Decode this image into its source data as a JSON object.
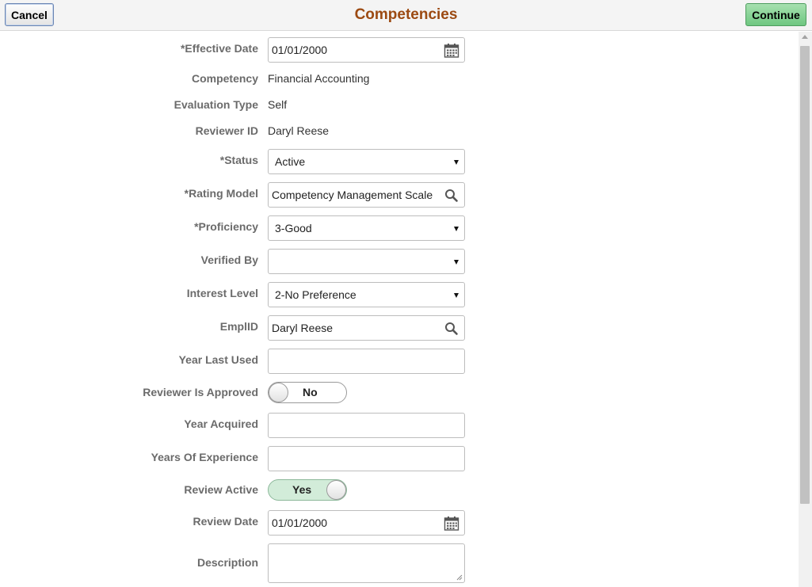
{
  "header": {
    "title": "Competencies",
    "cancel_label": "Cancel",
    "continue_label": "Continue"
  },
  "form": {
    "effective_date": {
      "label": "*Effective Date",
      "value": "01/01/2000",
      "icon": "calendar-icon"
    },
    "competency": {
      "label": "Competency",
      "value": "Financial Accounting"
    },
    "evaluation_type": {
      "label": "Evaluation Type",
      "value": "Self"
    },
    "reviewer_id": {
      "label": "Reviewer ID",
      "value": "Daryl Reese"
    },
    "status": {
      "label": "*Status",
      "value": "Active"
    },
    "rating_model": {
      "label": "*Rating Model",
      "value": "Competency Management Scale",
      "icon": "search-icon"
    },
    "proficiency": {
      "label": "*Proficiency",
      "value": "3-Good"
    },
    "verified_by": {
      "label": "Verified By",
      "value": ""
    },
    "interest_level": {
      "label": "Interest Level",
      "value": "2-No Preference"
    },
    "emplid": {
      "label": "EmplID",
      "value": "Daryl Reese",
      "icon": "search-icon"
    },
    "year_last_used": {
      "label": "Year Last Used",
      "value": ""
    },
    "reviewer_is_approved": {
      "label": "Reviewer Is Approved",
      "value": "No",
      "state": "off"
    },
    "year_acquired": {
      "label": "Year Acquired",
      "value": ""
    },
    "years_of_experience": {
      "label": "Years Of Experience",
      "value": ""
    },
    "review_active": {
      "label": "Review Active",
      "value": "Yes",
      "state": "on"
    },
    "review_date": {
      "label": "Review Date",
      "value": "01/01/2000",
      "icon": "calendar-icon"
    },
    "description": {
      "label": "Description",
      "value": ""
    }
  },
  "colors": {
    "title": "#9c4a12",
    "label": "#6b6b6b",
    "continue_button": "#6fc781",
    "toggle_on": "#d2ecd9"
  }
}
